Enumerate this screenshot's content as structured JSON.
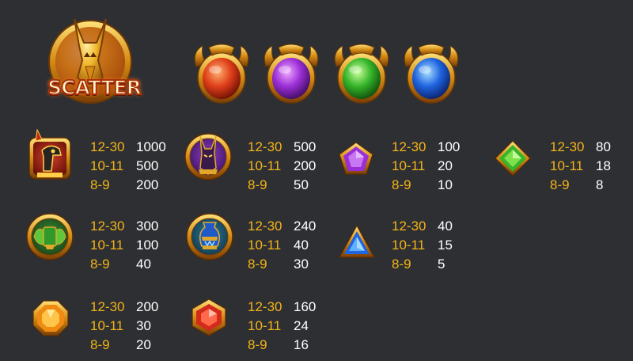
{
  "scatter": {
    "label": "SCATTER"
  },
  "orbs": [
    {
      "name": "red-orb-icon",
      "color": "#e0401a"
    },
    {
      "name": "purple-orb-icon",
      "color": "#9b2fd6"
    },
    {
      "name": "green-orb-icon",
      "color": "#35b52a"
    },
    {
      "name": "blue-orb-icon",
      "color": "#1f64e0"
    }
  ],
  "paytable": [
    {
      "symbol": "horus-falcon-icon",
      "rows": [
        {
          "range": "12-30",
          "payout": "1000"
        },
        {
          "range": "10-11",
          "payout": "500"
        },
        {
          "range": "8-9",
          "payout": "200"
        }
      ]
    },
    {
      "symbol": "anubis-icon",
      "rows": [
        {
          "range": "12-30",
          "payout": "500"
        },
        {
          "range": "10-11",
          "payout": "200"
        },
        {
          "range": "8-9",
          "payout": "50"
        }
      ]
    },
    {
      "symbol": "purple-pentagon-gem-icon",
      "rows": [
        {
          "range": "12-30",
          "payout": "100"
        },
        {
          "range": "10-11",
          "payout": "20"
        },
        {
          "range": "8-9",
          "payout": "10"
        }
      ]
    },
    {
      "symbol": "green-diamond-gem-icon",
      "rows": [
        {
          "range": "12-30",
          "payout": "80"
        },
        {
          "range": "10-11",
          "payout": "18"
        },
        {
          "range": "8-9",
          "payout": "8"
        }
      ]
    },
    {
      "symbol": "green-scarab-amulet-icon",
      "rows": [
        {
          "range": "12-30",
          "payout": "300"
        },
        {
          "range": "10-11",
          "payout": "100"
        },
        {
          "range": "8-9",
          "payout": "40"
        }
      ]
    },
    {
      "symbol": "blue-vase-icon",
      "rows": [
        {
          "range": "12-30",
          "payout": "240"
        },
        {
          "range": "10-11",
          "payout": "40"
        },
        {
          "range": "8-9",
          "payout": "30"
        }
      ]
    },
    {
      "symbol": "blue-triangle-gem-icon",
      "rows": [
        {
          "range": "12-30",
          "payout": "40"
        },
        {
          "range": "10-11",
          "payout": "15"
        },
        {
          "range": "8-9",
          "payout": "5"
        }
      ]
    },
    {
      "symbol": "orange-octagon-gem-icon",
      "rows": [
        {
          "range": "12-30",
          "payout": "200"
        },
        {
          "range": "10-11",
          "payout": "30"
        },
        {
          "range": "8-9",
          "payout": "20"
        }
      ]
    },
    {
      "symbol": "red-hexagon-gem-icon",
      "rows": [
        {
          "range": "12-30",
          "payout": "160"
        },
        {
          "range": "10-11",
          "payout": "24"
        },
        {
          "range": "8-9",
          "payout": "16"
        }
      ]
    }
  ]
}
